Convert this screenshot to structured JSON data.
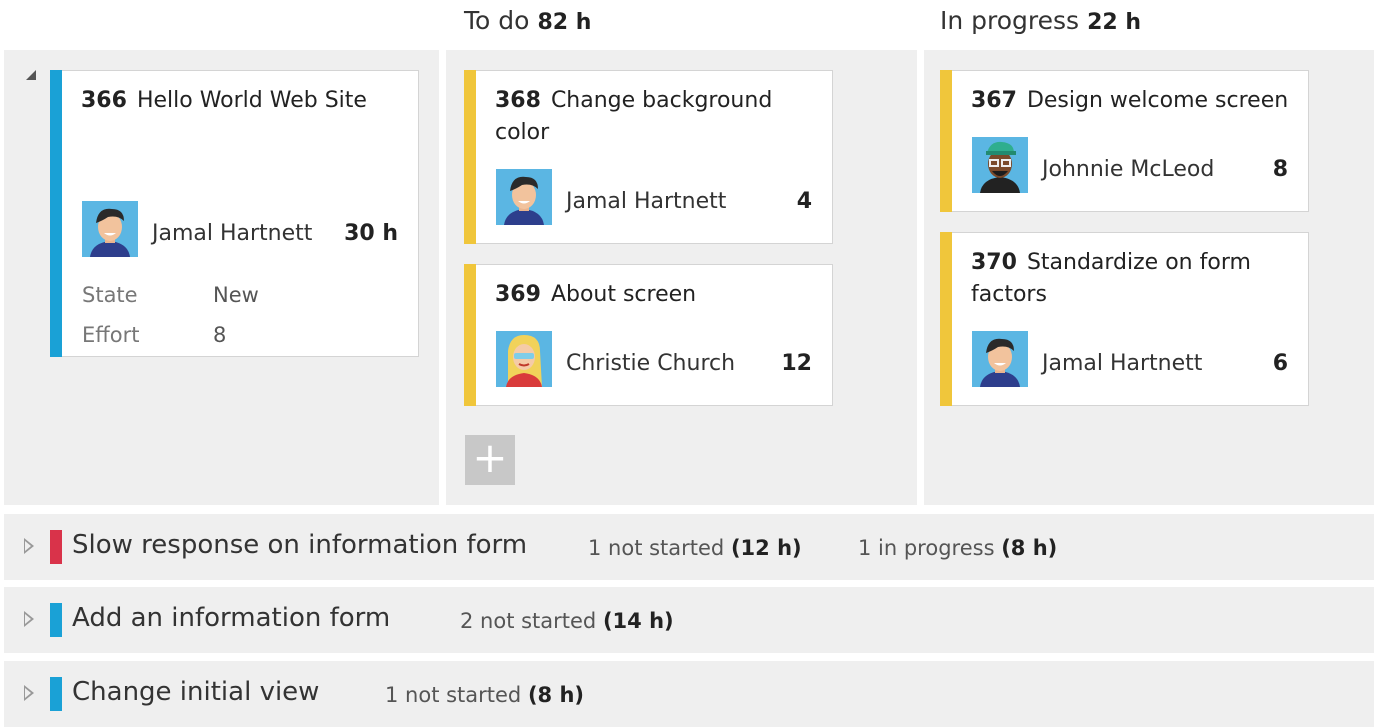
{
  "columns": [
    {
      "name": "To do",
      "hours": "82 h"
    },
    {
      "name": "In progress",
      "hours": "22 h"
    }
  ],
  "parent": {
    "id": "366",
    "title": "Hello World Web Site",
    "assignee": "Jamal Hartnett",
    "hours": "30 h",
    "state_label": "State",
    "state_value": "New",
    "effort_label": "Effort",
    "effort_value": "8",
    "color": "#1aa1d6"
  },
  "todo_cards": [
    {
      "id": "368",
      "title": "Change background color",
      "assignee": "Jamal Hartnett",
      "hours": "4"
    },
    {
      "id": "369",
      "title": "About screen",
      "assignee": "Christie Church",
      "hours": "12"
    }
  ],
  "inprogress_cards": [
    {
      "id": "367",
      "title": "Design welcome screen",
      "assignee": "Johnnie McLeod",
      "hours": "8"
    },
    {
      "id": "370",
      "title": "Standardize on form factors",
      "assignee": "Jamal Hartnett",
      "hours": "6"
    }
  ],
  "task_color": "#f0c63b",
  "add_label": "+",
  "rows": [
    {
      "title": "Slow response on information form",
      "color": "#d9334a",
      "not_started": "1 not started",
      "not_started_hours": "(12 h)",
      "in_progress": "1 in progress",
      "in_progress_hours": "(8 h)"
    },
    {
      "title": "Add an information form",
      "color": "#1aa1d6",
      "not_started": "2 not started",
      "not_started_hours": "(14 h)"
    },
    {
      "title": "Change initial view",
      "color": "#1aa1d6",
      "not_started": "1 not started",
      "not_started_hours": "(8 h)"
    }
  ],
  "icons": {
    "collapse": "collapse-triangle-icon",
    "expand": "expand-triangle-icon",
    "avatar_jamal": "avatar-jamal-icon",
    "avatar_christie": "avatar-christie-icon",
    "avatar_johnnie": "avatar-johnnie-icon"
  }
}
